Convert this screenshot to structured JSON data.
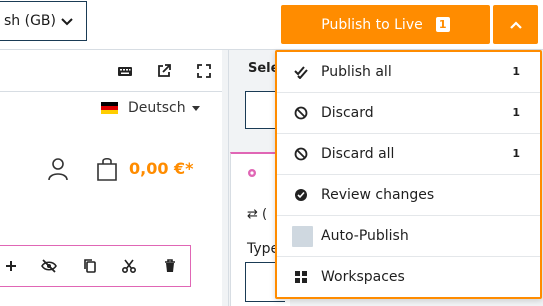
{
  "topbar": {
    "language_select_value": "sh (GB)",
    "publish_button_label": "Publish to Live",
    "publish_count": "1"
  },
  "preview": {
    "language_switch_label": "Deutsch",
    "cart_total": "0,00 €*"
  },
  "sidepanel": {
    "title_fragment": "Sele",
    "swap_fragment": "⇄  (",
    "type_label_fragment": "Type"
  },
  "publish_menu": {
    "items": [
      {
        "label": "Publish all",
        "count": "1",
        "icon": "double-check-icon"
      },
      {
        "label": "Discard",
        "count": "1",
        "icon": "ban-icon"
      },
      {
        "label": "Discard all",
        "count": "1",
        "icon": "ban-icon"
      },
      {
        "label": "Review changes",
        "count": "",
        "icon": "check-circle-icon"
      },
      {
        "label": "Auto-Publish",
        "count": "",
        "icon": "checkbox"
      },
      {
        "label": "Workspaces",
        "count": "",
        "icon": "grid-icon"
      }
    ]
  },
  "colors": {
    "accent": "#ff8c00",
    "outline_pink": "#e066b5",
    "navy_border": "#1a3b55",
    "panel_grey": "#f1f3f5"
  }
}
